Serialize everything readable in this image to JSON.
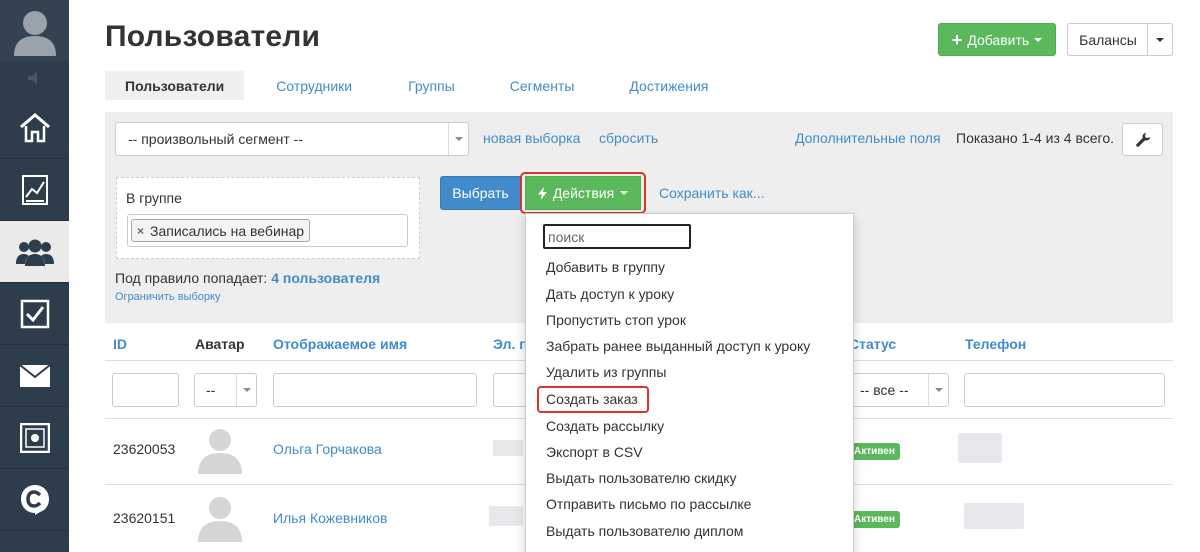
{
  "header": {
    "title": "Пользователи",
    "add_label": "Добавить",
    "balances_label": "Балансы"
  },
  "tabs": [
    {
      "label": "Пользователи",
      "active": true
    },
    {
      "label": "Сотрудники"
    },
    {
      "label": "Группы"
    },
    {
      "label": "Сегменты"
    },
    {
      "label": "Достижения"
    }
  ],
  "filter": {
    "segment_value": "-- произвольный сегмент --",
    "new_selection_link": "новая выборка",
    "reset_link": "сбросить",
    "extra_fields_link": "Дополнительные поля",
    "shown_text": "Показано 1-4 из 4 всего.",
    "group_label": "В группе",
    "group_tag": "Записались на вебинар",
    "select_button": "Выбрать",
    "actions_button": "Действия",
    "save_as_link": "Сохранить как...",
    "rule_prefix": "Под правило попадает:",
    "rule_count": "4 пользователя",
    "limit_link": "Ограничить выборку"
  },
  "table": {
    "columns": [
      "ID",
      "Аватар",
      "Отображаемое имя",
      "Эл. п",
      "Статус",
      "Телефон"
    ],
    "filters": {
      "avatar_select": "--",
      "status_select": "-- все --"
    },
    "rows": [
      {
        "id": "23620053",
        "name": "Ольга Горчакова",
        "status": "Активен"
      },
      {
        "id": "23620151",
        "name": "Илья Кожевников",
        "status": "Активен"
      }
    ]
  },
  "actions_menu": {
    "search_placeholder": "поиск",
    "items": [
      "Добавить в группу",
      "Дать доступ к уроку",
      "Пропустить стоп урок",
      "Забрать ранее выданный доступ к уроку",
      "Удалить из группы",
      "Создать заказ",
      "Создать рассылку",
      "Экспорт в CSV",
      "Выдать пользователю скидку",
      "Отправить письмо по рассылке",
      "Выдать пользователю диплом"
    ],
    "highlighted_item": "Создать заказ"
  },
  "sidebar": {
    "items": [
      {
        "icon": "home-icon"
      },
      {
        "icon": "chart-icon"
      },
      {
        "icon": "users-icon",
        "active": true
      },
      {
        "icon": "checkbox-icon"
      },
      {
        "icon": "mail-icon"
      },
      {
        "icon": "safe-icon"
      },
      {
        "icon": "chat-logo-icon"
      }
    ]
  },
  "colors": {
    "sidebar_bg": "#2e3d4b",
    "primary_blue": "#428bca",
    "success_green": "#5cb85c",
    "highlight_red": "#d9332b"
  }
}
